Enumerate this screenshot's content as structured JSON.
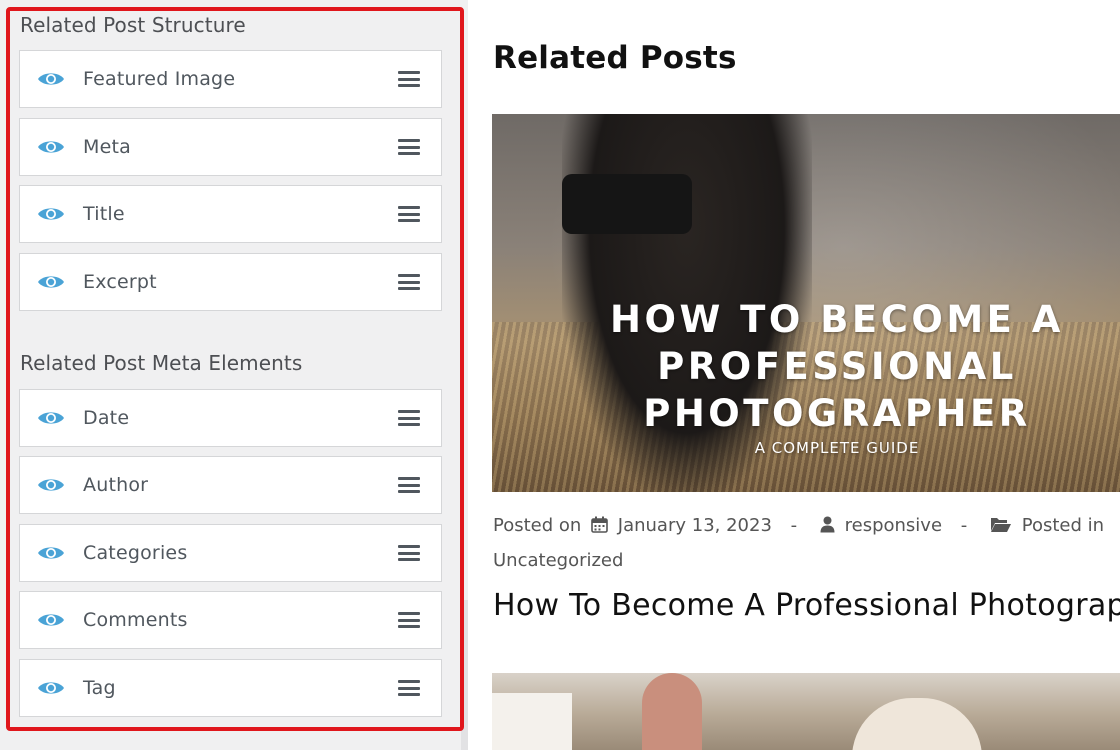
{
  "panel": {
    "structure_title": "Related Post Structure",
    "structure_items": [
      {
        "label": "Featured Image"
      },
      {
        "label": "Meta"
      },
      {
        "label": "Title"
      },
      {
        "label": "Excerpt"
      }
    ],
    "meta_title": "Related Post Meta Elements",
    "meta_items": [
      {
        "label": "Date"
      },
      {
        "label": "Author"
      },
      {
        "label": "Categories"
      },
      {
        "label": "Comments"
      },
      {
        "label": "Tag"
      }
    ],
    "item_icons": [
      "eye-icon",
      "drag-handle-icon"
    ],
    "highlight_color": "#e0161c",
    "icon_color": "#4aa3d6"
  },
  "preview": {
    "title": "Related Posts",
    "image_headline": "HOW TO BECOME A\nPROFESSIONAL\nPHOTOGRAPHER",
    "image_tagline": "A COMPLETE GUIDE",
    "meta": {
      "posted_on": "Posted on",
      "date": "January 13, 2023",
      "separator": "-",
      "author": "responsive",
      "posted_in": "Posted in",
      "category": "Uncategorized"
    },
    "post_title": "How To Become A Professional Photographer"
  }
}
